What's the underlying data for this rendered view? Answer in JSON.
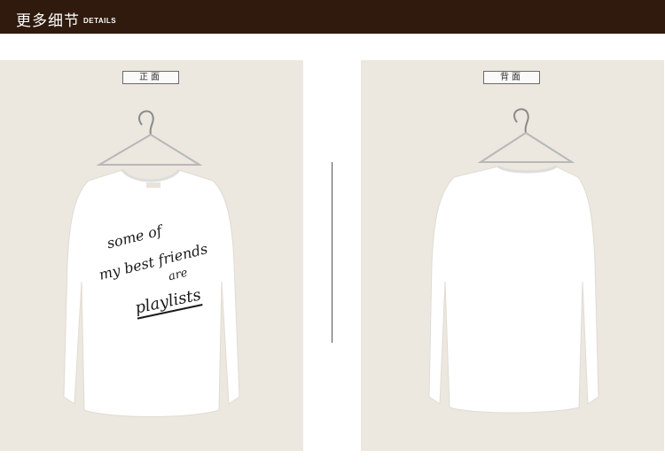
{
  "header": {
    "title": "更多细节",
    "subtitle": "DETAILS"
  },
  "front": {
    "label": "正面",
    "print_text": [
      "some of",
      "my best friends",
      "are",
      "playlists"
    ]
  },
  "back": {
    "label": "背面"
  },
  "colors": {
    "header_bg": "#2f1a0d",
    "photo_bg": "#ece7df",
    "shirt": "#ffffff",
    "print_ink": "#1a1a1a"
  }
}
